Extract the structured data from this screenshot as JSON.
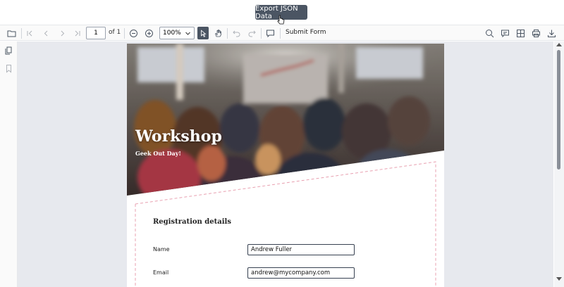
{
  "tooltip": {
    "text": "Export JSON Data"
  },
  "toolbar": {
    "page_number": "1",
    "page_of": "of 1",
    "zoom": "100%",
    "submit_form": "Submit Form"
  },
  "document": {
    "hero_title": "Workshop",
    "hero_subtitle": "Geek Out Day!",
    "section_title": "Registration details",
    "fields": [
      {
        "label": "Name",
        "value": "Andrew Fuller"
      },
      {
        "label": "Email",
        "value": "andrew@mycompany.com"
      }
    ]
  },
  "icons": {
    "open": "folder-open-icon",
    "first_page": "first-page-icon",
    "prev_page": "prev-page-icon",
    "next_page": "next-page-icon",
    "last_page": "last-page-icon",
    "zoom_out": "zoom-out-icon",
    "zoom_in": "zoom-in-icon",
    "select_tool": "text-select-icon",
    "pan_tool": "pan-hand-icon",
    "undo": "undo-icon",
    "redo": "redo-icon",
    "comment": "comment-icon",
    "search": "search-icon",
    "annotation": "annotation-icon",
    "form_designer": "form-designer-icon",
    "print": "print-icon",
    "download": "download-icon",
    "thumbnails": "page-thumbnails-icon",
    "bookmarks": "bookmark-icon"
  },
  "colors": {
    "accent_dark": "#4b5563",
    "dashed_border": "#e8a0b0",
    "viewer_bg": "#e7e9ee"
  }
}
